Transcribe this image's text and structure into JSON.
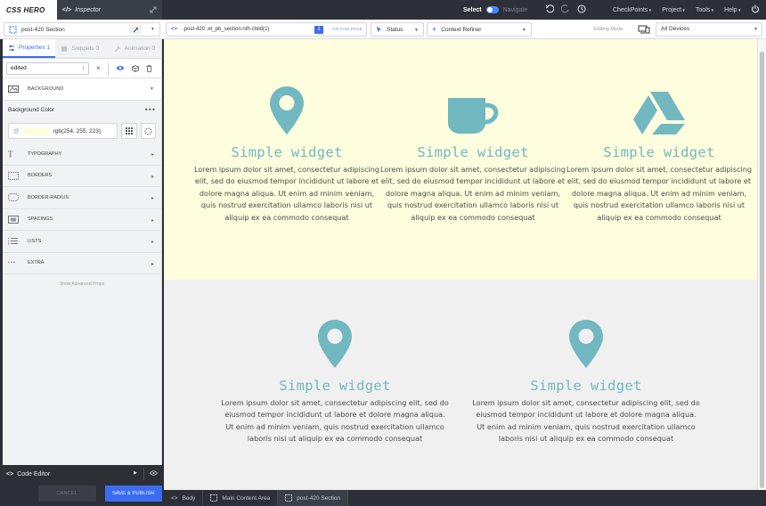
{
  "app": {
    "logo": "CSS HERO",
    "inspector_tab": "Inspector"
  },
  "topbar": {
    "select_label": "Select",
    "navigate_label": "Navigate",
    "menus": [
      "CheckPoints",
      "Project",
      "Tools",
      "Help"
    ]
  },
  "toolbar": {
    "selection": "post-420 Section",
    "selector_path": ".post-420 .et_pb_section:nth-child(1)",
    "match_count": "1",
    "on_this_page": "ON THIS PAGE",
    "status": "Status",
    "context_refiner": "Context Refiner",
    "editing_mode_label": "Editing Mode:",
    "device": "All Devices"
  },
  "panel": {
    "tabs": [
      {
        "label": "Properties 1"
      },
      {
        "label": "Snippets 0"
      },
      {
        "label": "Animation 0"
      }
    ],
    "search_value": "edited",
    "search_count": "1",
    "background_label": "BACKGROUND",
    "bg_color_title": "Background Color",
    "bg_color_value": "rgb(254, 255, 223)",
    "bg_color_hex": "#fefedf",
    "groups": [
      {
        "label": "TYPOGRAPHY"
      },
      {
        "label": "BORDERS"
      },
      {
        "label": "BORDER-RADIUS"
      },
      {
        "label": "SPACINGS"
      },
      {
        "label": "LISTS"
      },
      {
        "label": "EXTRA"
      }
    ],
    "advanced_link": "Show Advanced Props",
    "code_editor": "Code Editor",
    "cancel": "CANCEL",
    "save": "SAVE & PUBLISH"
  },
  "preview": {
    "accent": "#71b8c1",
    "section1_bg": "#fefedf",
    "section2_bg": "#f0f0f0",
    "row1": [
      {
        "icon": "map-pin-icon",
        "title": "Simple widget",
        "text": "Lorem ipsum dolor sit amet, consectetur adipiscing elit, sed do eiusmod tempor incididunt ut labore et dolore magna aliqua. Ut enim ad minim veniam, quis nostrud exercitation ullamco laboris nisi ut aliquip ex ea commodo consequat"
      },
      {
        "icon": "coffee-cup-icon",
        "title": "Simple widget",
        "text": "Lorem ipsum dolor sit amet, consectetur adipiscing elit, sed do eiusmod tempor incididunt ut labore et dolore magna aliqua. Ut enim ad minim veniam, quis nostrud exercitation ullamco laboris nisi ut aliquip ex ea commodo consequat"
      },
      {
        "icon": "drive-icon",
        "title": "Simple widget",
        "text": "Lorem ipsum dolor sit amet, consectetur adipiscing elit, sed do eiusmod tempor incididunt ut labore et dolore magna aliqua. Ut enim ad minim veniam, quis nostrud exercitation ullamco laboris nisi ut aliquip ex ea commodo consequat"
      }
    ],
    "row2": [
      {
        "icon": "map-pin-icon",
        "title": "Simple widget",
        "text": "Lorem ipsum dolor sit amet, consectetur adipiscing elit, sed do eiusmod tempor incididunt ut labore et dolore magna aliqua. Ut enim ad minim veniam, quis nostrud exercitation ullamco laboris nisi ut aliquip ex ea commodo consequat"
      },
      {
        "icon": "map-pin-icon",
        "title": "Simple widget",
        "text": "Lorem ipsum dolor sit amet, consectetur adipiscing elit, sed do eiusmod tempor incididunt ut labore et dolore magna aliqua. Ut enim ad minim veniam, quis nostrud exercitation ullamco laboris nisi ut aliquip ex ea commodo consequat"
      }
    ]
  },
  "breadcrumbs": [
    "Body",
    "Main Content Area",
    "post-420 Section"
  ]
}
